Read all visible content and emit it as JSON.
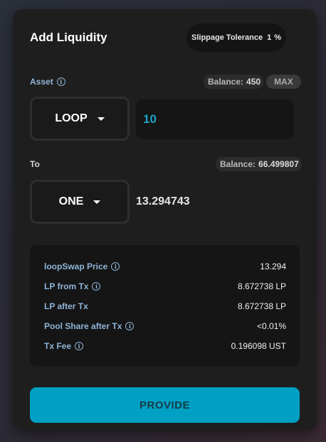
{
  "header": {
    "title": "Add Liquidity"
  },
  "slippage": {
    "label": "Slippage Tolerance",
    "value": "1",
    "unit": "%"
  },
  "asset_section": {
    "label": "Asset",
    "balance_label": "Balance:",
    "balance_value": "450",
    "max_label": "MAX",
    "selected_token": "LOOP",
    "amount": "10"
  },
  "to_section": {
    "label": "To",
    "balance_label": "Balance:",
    "balance_value": "66.499807",
    "selected_token": "ONE",
    "amount": "13.294743"
  },
  "details": {
    "rows": [
      {
        "label": "loopSwap Price",
        "value": "13.294",
        "has_info": true
      },
      {
        "label": "LP from Tx",
        "value": "8.672738 LP",
        "has_info": true
      },
      {
        "label": "LP after Tx",
        "value": "8.672738 LP",
        "has_info": false
      },
      {
        "label": "Pool Share after Tx",
        "value": "<0.01%",
        "has_info": true
      },
      {
        "label": "Tx Fee",
        "value": "0.196098 UST",
        "has_info": true
      }
    ]
  },
  "provide_button": {
    "label": "PROVIDE"
  },
  "colors": {
    "accent": "#00a0c4",
    "label": "#8fb4d6",
    "card": "#1e1e1e"
  },
  "icons": {
    "info": "info-circle-icon",
    "dropdown": "chevron-down-icon"
  }
}
